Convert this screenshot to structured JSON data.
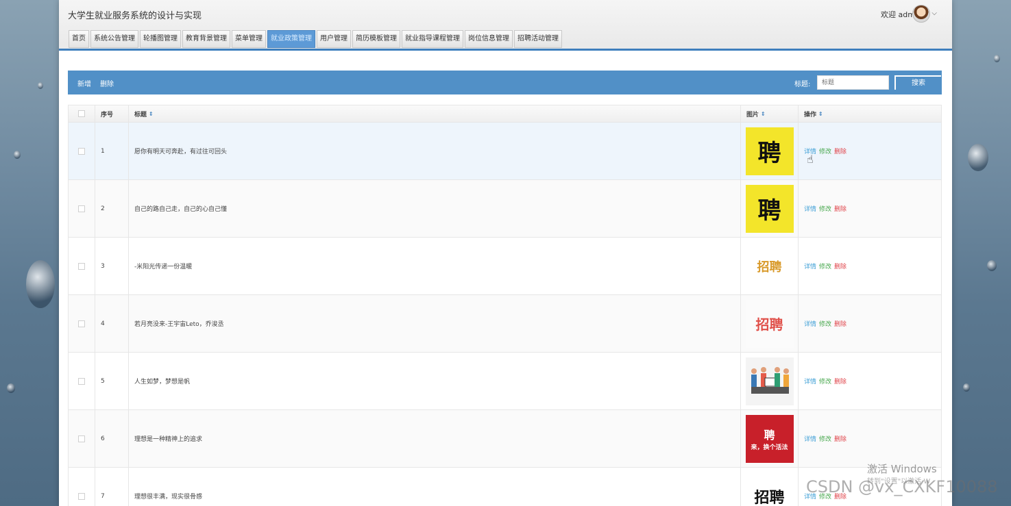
{
  "header": {
    "title": "大学生就业服务系统的设计与实现",
    "welcome": "欢迎 admin",
    "caret": "⌵"
  },
  "tabs": [
    {
      "label": "首页",
      "active": false
    },
    {
      "label": "系统公告管理",
      "active": false
    },
    {
      "label": "轮播图管理",
      "active": false
    },
    {
      "label": "教育背景管理",
      "active": false
    },
    {
      "label": "菜单管理",
      "active": false
    },
    {
      "label": "就业政策管理",
      "active": true
    },
    {
      "label": "用户管理",
      "active": false
    },
    {
      "label": "简历模板管理",
      "active": false
    },
    {
      "label": "就业指导课程管理",
      "active": false
    },
    {
      "label": "岗位信息管理",
      "active": false
    },
    {
      "label": "招聘活动管理",
      "active": false
    }
  ],
  "toolbar": {
    "add": "新增",
    "delete": "删除",
    "search_label": "标题:",
    "search_placeholder": "标题",
    "search_button": "搜索"
  },
  "table": {
    "columns": [
      "序号",
      "标题",
      "图片",
      "操作"
    ],
    "sort_icon": "⇕",
    "actions": {
      "detail": "详情",
      "edit": "修改",
      "delete": "删除"
    },
    "rows": [
      {
        "no": "1",
        "title": "愿你有明天可奔赴，有过往可回头",
        "thumb": "聘"
      },
      {
        "no": "2",
        "title": "自己的路自己走，自己的心自己懂",
        "thumb": "聘"
      },
      {
        "no": "3",
        "title": "-米阳光传递一份温暖",
        "thumb": "招聘"
      },
      {
        "no": "4",
        "title": "若月亮没来-王宇宙Leto，乔浚丞",
        "thumb": "招聘"
      },
      {
        "no": "5",
        "title": "人生如梦，梦想是帆",
        "thumb": ""
      },
      {
        "no": "6",
        "title": "理想是一种精神上的追求",
        "thumb_top": "聘",
        "thumb_bottom": "来，换个活法"
      },
      {
        "no": "7",
        "title": "理想很丰满，现实很骨感",
        "thumb": "招聘"
      }
    ]
  },
  "watermark": {
    "line1": "激活 Windows",
    "line2": "转到\"设置\"以激活 W",
    "csdn": "CSDN @vx_CXKF10088"
  }
}
